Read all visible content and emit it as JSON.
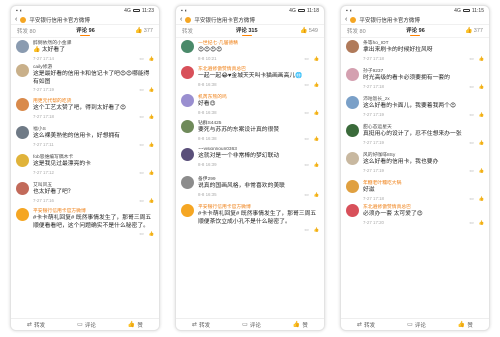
{
  "colors": {
    "accent": "#ff8200",
    "vip_name": "#ef7e12"
  },
  "phones": [
    {
      "status": {
        "left": "▪ ◖",
        "time": "11:23",
        "signal": "4G"
      },
      "title": "平安银行信用卡官方微博",
      "tabs": {
        "repost": "转发 80",
        "comment": "评论 96",
        "like": "377"
      },
      "comments": [
        {
          "name": "醉倒依然的小金驿",
          "vip": false,
          "text": "👍 太好看了",
          "time": "7-27 17:14",
          "color": "#8a9bb0",
          "h": 24
        },
        {
          "name": "caily修游",
          "vip": false,
          "text": "这是最好看的信用卡和信记卡了吧😍😍哪能得有如图",
          "time": "7-27 17:19",
          "color": "#c9b08a",
          "h": 34
        },
        {
          "name": "用更元代帮的吃货",
          "vip": true,
          "text": "这个工艺太赞了吧，得到太好看了😍",
          "time": "7-27 17:18",
          "color": "#d98a4b",
          "h": 28
        },
        {
          "name": "福小S",
          "vip": false,
          "text": "这么裸美熟他的信用卡，好想拥有",
          "time": "7-27 17:11",
          "color": "#6f7a86",
          "h": 28
        },
        {
          "name": "fob思维编写稿木卡",
          "vip": false,
          "text": "这是我见过最漂亮的卡",
          "time": "7-27 17:12",
          "color": "#e0b33a",
          "h": 28
        },
        {
          "name": "艾叫风五",
          "vip": false,
          "text": "也太好看了吧？",
          "time": "7-27 17:16",
          "color": "#c26a5a",
          "h": 26
        },
        {
          "name": "平安银行信用卡官方微博",
          "vip": true,
          "text": "#卡卡萌礼回复# 既然事情发生了，那哥三周五顺便看看吧，这个问题确实不是什么秘密了。",
          "time": "",
          "color": "#f5a623",
          "h": 34
        }
      ],
      "bottom": {
        "repost": "转发",
        "comment": "评论",
        "like": "赞"
      }
    },
    {
      "status": {
        "left": "▪ ◖",
        "time": "11:18",
        "signal": "4G"
      },
      "title": "平安银行信用卡官方微博",
      "tabs": {
        "repost": "转发",
        "comment": "评论 315",
        "like": "549"
      },
      "comments": [
        {
          "name": "一世纪七·几届德精",
          "vip": true,
          "text": "😍😍😍😍",
          "time": "8-8 10:21",
          "color": "#4a8a6a",
          "h": 26
        },
        {
          "name": "东北遍修傲赞情真总巴",
          "vip": true,
          "text": "一起一起😂♥金城天天叫卡猫画画高儿🌐",
          "time": "8-8 16:38",
          "color": "#d8505a",
          "h": 28
        },
        {
          "name": "机芮东熊的鸣",
          "vip": true,
          "text": "好看😍",
          "time": "8-8 16:38",
          "color": "#9a8fd0",
          "h": 26
        },
        {
          "name": "钻群S4425",
          "vip": false,
          "text": "要死与苏苏的东案设计真的很赞",
          "time": "8-8 16:38",
          "color": "#6f8a5a",
          "h": 28
        },
        {
          "name": "~~vision/ioun0363",
          "vip": false,
          "text": "这就对是一个非常棒的梦幻联动",
          "time": "8-8 16:39",
          "color": "#5a4f7a",
          "h": 28
        },
        {
          "name": "备伊299",
          "vip": false,
          "text": "说真的国画风格，非常喜欢的美联",
          "time": "8-8 16:35",
          "color": "#8c8c8c",
          "h": 28
        },
        {
          "name": "平安银行信用卡官方微博",
          "vip": true,
          "text": "#卡卡萌礼回复# 既然事情发生了，那哥三周五顺便茶饮立成小孔不是什么秘密了。",
          "time": "",
          "color": "#f5a623",
          "h": 34
        }
      ],
      "bottom": {
        "repost": "转发",
        "comment": "评论",
        "like": "赞"
      }
    },
    {
      "status": {
        "left": "▪ ◖",
        "time": "11:15",
        "signal": "4G"
      },
      "title": "平安银行信用卡官方微博",
      "tabs": {
        "repost": "转发 80",
        "comment": "评论 96",
        "like": "377"
      },
      "comments": [
        {
          "name": "条等ho_IOT",
          "vip": false,
          "text": "拿出来刷卡的时候好拉风呀",
          "time": "7-27 17:18",
          "color": "#b07a5a",
          "h": 28
        },
        {
          "name": "孙子9237",
          "vip": false,
          "text": "时光高级的看卡必须要拥有一套的",
          "time": "7-27 17:18",
          "color": "#d4a0b0",
          "h": 28
        },
        {
          "name": "沛咕饭长_zx",
          "vip": false,
          "text": "这么好看的卡面儿，我要着我两个😍",
          "time": "7-27 17:19",
          "color": "#7aa0c8",
          "h": 28
        },
        {
          "name": "甜心态运星天",
          "vip": false,
          "text": "真挺用心的设计了，忍不住想来办一张",
          "time": "7-27 17:19",
          "color": "#3a6a3a",
          "h": 28
        },
        {
          "name": "风的好咖啡8Sy",
          "vip": false,
          "text": "这么好看的信用卡，我也要办",
          "time": "7-27 17:19",
          "color": "#c8b8a0",
          "h": 28
        },
        {
          "name": "年糖老叶糯吃大锅",
          "vip": true,
          "text": "好滋",
          "time": "7-27 17:18",
          "color": "#e0a040",
          "h": 24
        },
        {
          "name": "东北遍修傲赞情真总巴",
          "vip": true,
          "text": "必须办一套 太可爱了😍",
          "time": "7-27 17:20",
          "color": "#d8505a",
          "h": 26
        }
      ],
      "bottom": {
        "repost": "转发",
        "comment": "评论",
        "like": "赞"
      }
    }
  ]
}
